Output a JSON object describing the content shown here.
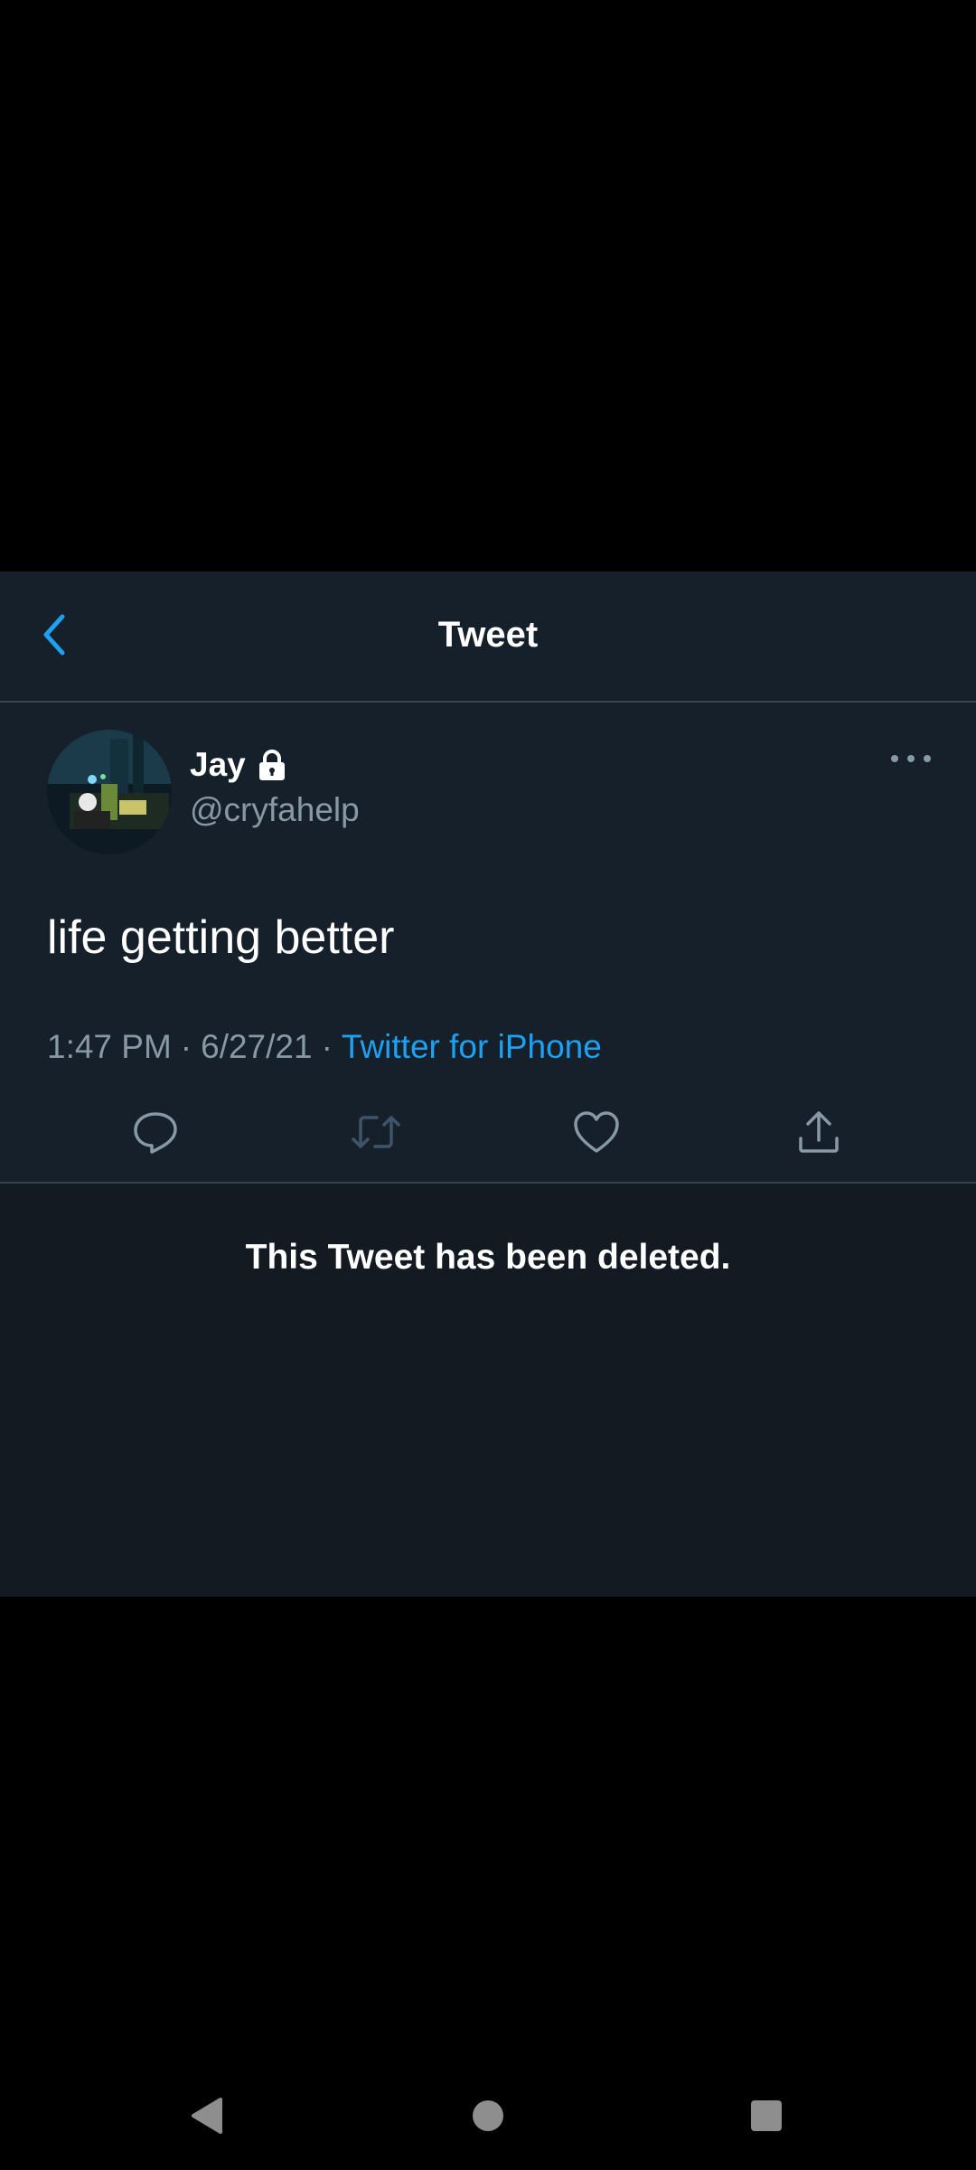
{
  "header": {
    "title": "Tweet",
    "back_icon": "chevron-left-icon"
  },
  "tweet": {
    "display_name": "Jay",
    "handle": "@cryfahelp",
    "text": "life getting better",
    "time": "1:47 PM",
    "date": "6/27/21",
    "separator": "·",
    "source": "Twitter for iPhone",
    "icons": {
      "lock": "lock-icon",
      "more": "more-options-icon",
      "reply": "reply-icon",
      "retweet": "retweet-icon",
      "like": "heart-icon",
      "share": "share-icon"
    }
  },
  "deleted_notice": "This Tweet has been deleted.",
  "colors": {
    "background": "#15202b",
    "deleted_background": "#131a22",
    "accent": "#1da1f2",
    "secondary_text": "#8899a6",
    "divider": "#38444d"
  },
  "navbar": {
    "icons": [
      "back-triangle-icon",
      "home-circle-icon",
      "recents-square-icon"
    ]
  }
}
